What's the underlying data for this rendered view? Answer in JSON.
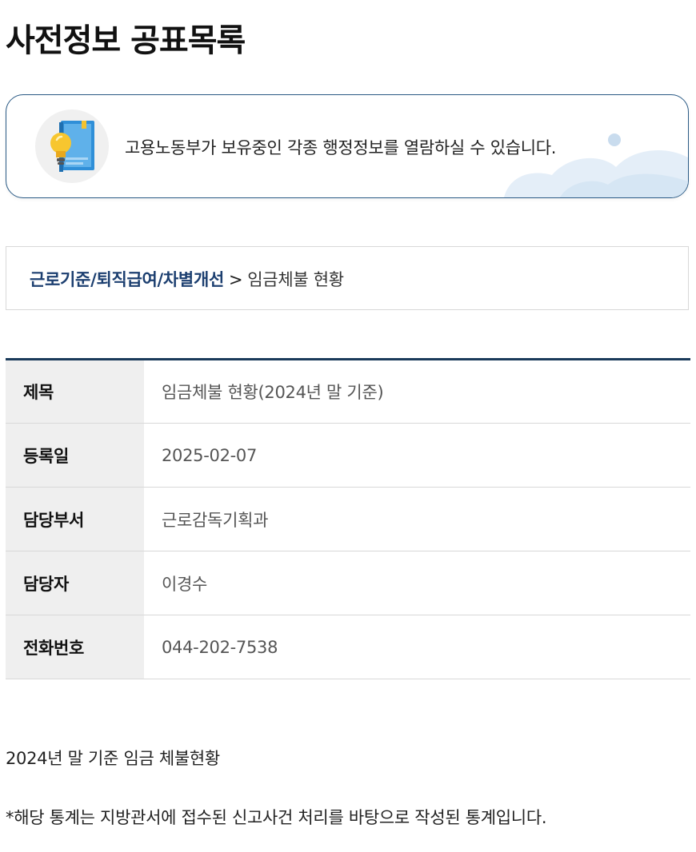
{
  "page": {
    "title": "사전정보 공표목록"
  },
  "notice": {
    "icon": "lightbulb-book-icon",
    "text": "고용노동부가 보유중인 각종 행정정보를 열람하실 수 있습니다."
  },
  "breadcrumb": {
    "parent": "근로기준/퇴직급여/차별개선",
    "separator": ">",
    "current": "임금체불 현황"
  },
  "details": {
    "rows": [
      {
        "label": "제목",
        "value": "임금체불 현황(2024년 말 기준)"
      },
      {
        "label": "등록일",
        "value": "2025-02-07"
      },
      {
        "label": "담당부서",
        "value": "근로감독기획과"
      },
      {
        "label": "담당자",
        "value": "이경수"
      },
      {
        "label": "전화번호",
        "value": "044-202-7538"
      }
    ]
  },
  "content": {
    "line1": "2024년 말 기준 임금 체불현황",
    "line2": "*해당 통계는 지방관서에 접수된 신고사건 처리를 바탕으로 작성된 통계입니다."
  },
  "colors": {
    "accent": "#1c3f70",
    "box_border": "#2a5a85",
    "table_top_border": "#1a3a5a",
    "header_cell_bg": "#efefef"
  }
}
